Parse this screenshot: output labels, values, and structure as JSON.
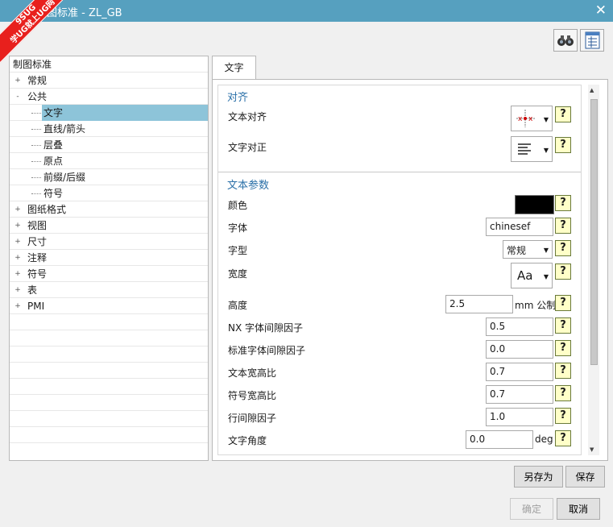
{
  "window": {
    "title": "图标准 - ZL_GB",
    "close_label": "✕",
    "watermark_line1": "9SUG",
    "watermark_line2": "学UG就上UG网"
  },
  "toolbar": {
    "search_icon": "binoculars-icon",
    "sheet_icon": "spreadsheet-icon"
  },
  "tree": {
    "root": "制图标准",
    "items": [
      {
        "label": "常规",
        "sign": "+",
        "level": 1
      },
      {
        "label": "公共",
        "sign": "-",
        "level": 1
      },
      {
        "label": "文字",
        "sign": "",
        "level": 2,
        "selected": true
      },
      {
        "label": "直线/箭头",
        "sign": "",
        "level": 2
      },
      {
        "label": "层叠",
        "sign": "",
        "level": 2
      },
      {
        "label": "原点",
        "sign": "",
        "level": 2
      },
      {
        "label": "前缀/后缀",
        "sign": "",
        "level": 2
      },
      {
        "label": "符号",
        "sign": "",
        "level": 2
      },
      {
        "label": "图纸格式",
        "sign": "+",
        "level": 1
      },
      {
        "label": "视图",
        "sign": "+",
        "level": 1
      },
      {
        "label": "尺寸",
        "sign": "+",
        "level": 1
      },
      {
        "label": "注释",
        "sign": "+",
        "level": 1
      },
      {
        "label": "符号",
        "sign": "+",
        "level": 1
      },
      {
        "label": "表",
        "sign": "+",
        "level": 1
      },
      {
        "label": "PMI",
        "sign": "+",
        "level": 1
      }
    ]
  },
  "tabs": [
    {
      "label": "文字"
    }
  ],
  "alignment": {
    "section_title": "对齐",
    "text_align_label": "文本对齐",
    "text_justify_label": "文字对正"
  },
  "params": {
    "section_title": "文本参数",
    "color_label": "颜色",
    "color_value": "#000000",
    "font_label": "字体",
    "font_value": "chinesef",
    "style_label": "字型",
    "style_value": "常规",
    "width_label": "宽度",
    "width_value": "Aa",
    "height_label": "高度",
    "height_value": "2.5",
    "height_unit": "mm 公制",
    "nx_gap_label": "NX 字体间隙因子",
    "nx_gap_value": "0.5",
    "std_gap_label": "标准字体间隙因子",
    "std_gap_value": "0.0",
    "text_aspect_label": "文本宽高比",
    "text_aspect_value": "0.7",
    "symbol_aspect_label": "符号宽高比",
    "symbol_aspect_value": "0.7",
    "line_gap_label": "行间隙因子",
    "line_gap_value": "1.0",
    "angle_label": "文字角度",
    "angle_value": "0.0",
    "angle_unit": "deg"
  },
  "help_label": "?",
  "buttons": {
    "save_as": "另存为",
    "save": "保存",
    "ok": "确定",
    "cancel": "取消"
  },
  "colors": {
    "titlebar": "#56a0bf",
    "selected": "#8dc4d9",
    "section": "#2a70a8"
  }
}
